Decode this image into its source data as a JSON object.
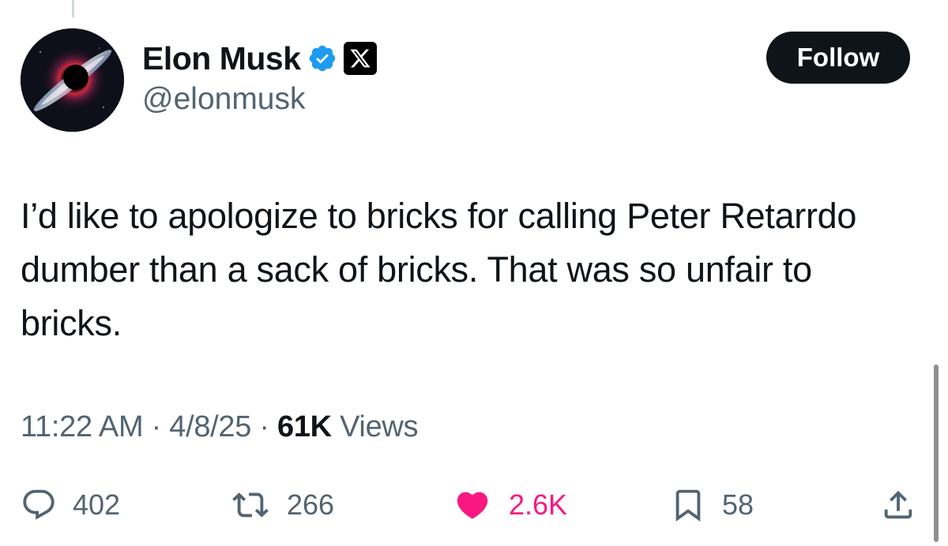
{
  "author": {
    "display_name": "Elon Musk",
    "handle": "@elonmusk",
    "verified_color": "#1d9bf0",
    "badge_icon": "x-logo-icon"
  },
  "follow_label": "Follow",
  "tweet": {
    "text": "I’d like to apologize to bricks for calling Peter Retarrdo dumber than a sack of bricks. That was so unfair to bricks."
  },
  "meta": {
    "time": "11:22 AM",
    "separator1": "·",
    "date": "4/8/25",
    "separator2": "·",
    "views_count": "61K",
    "views_label": "Views"
  },
  "actions": {
    "replies": "402",
    "reposts": "266",
    "likes": "2.6K",
    "bookmarks": "58"
  },
  "colors": {
    "like": "#f91880",
    "muted": "#536471",
    "text": "#0f1419"
  }
}
